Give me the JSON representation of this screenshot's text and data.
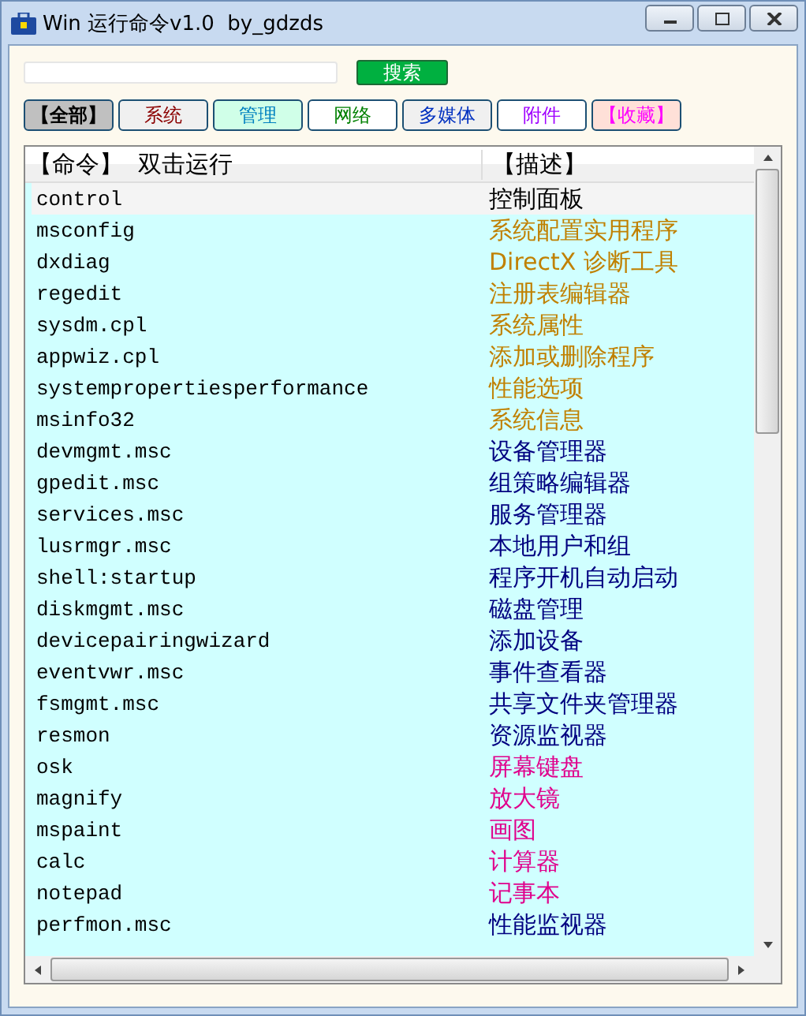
{
  "window": {
    "title": "Win 运行命令v1.0  by_gdzds"
  },
  "search": {
    "button": "搜索"
  },
  "tabs": [
    {
      "label": "【全部】",
      "selected": true,
      "color": "#000000"
    },
    {
      "label": "系统",
      "selected": false,
      "color": "#8b0000"
    },
    {
      "label": "管理",
      "selected": false,
      "color": "#0080c0"
    },
    {
      "label": "网络",
      "selected": false,
      "color": "#008000"
    },
    {
      "label": "多媒体",
      "selected": false,
      "color": "#0030c0"
    },
    {
      "label": "附件",
      "selected": false,
      "color": "#a000ff"
    },
    {
      "label": "【收藏】",
      "selected": false,
      "color": "#ff00ff"
    }
  ],
  "table": {
    "columns": [
      "【命令】  双击运行",
      "【描述】"
    ],
    "rows": [
      {
        "command": "control",
        "description": "控制面板",
        "selected": true,
        "color": "#000000"
      },
      {
        "command": "msconfig",
        "description": "系统配置实用程序",
        "selected": false,
        "color": "#c08000"
      },
      {
        "command": "dxdiag",
        "description": "DirectX 诊断工具",
        "selected": false,
        "color": "#c08000"
      },
      {
        "command": "regedit",
        "description": "注册表编辑器",
        "selected": false,
        "color": "#c08000"
      },
      {
        "command": "sysdm.cpl",
        "description": "系统属性",
        "selected": false,
        "color": "#c08000"
      },
      {
        "command": "appwiz.cpl",
        "description": "添加或删除程序",
        "selected": false,
        "color": "#c08000"
      },
      {
        "command": "systempropertiesperformance",
        "description": "性能选项",
        "selected": false,
        "color": "#c08000"
      },
      {
        "command": "msinfo32",
        "description": "系统信息",
        "selected": false,
        "color": "#c08000"
      },
      {
        "command": "devmgmt.msc",
        "description": "设备管理器",
        "selected": false,
        "color": "#000080"
      },
      {
        "command": "gpedit.msc",
        "description": "组策略编辑器",
        "selected": false,
        "color": "#000080"
      },
      {
        "command": "services.msc",
        "description": "服务管理器",
        "selected": false,
        "color": "#000080"
      },
      {
        "command": "lusrmgr.msc",
        "description": "本地用户和组",
        "selected": false,
        "color": "#000080"
      },
      {
        "command": "shell:startup",
        "description": "程序开机自动启动",
        "selected": false,
        "color": "#000080"
      },
      {
        "command": "diskmgmt.msc",
        "description": "磁盘管理",
        "selected": false,
        "color": "#000080"
      },
      {
        "command": "devicepairingwizard",
        "description": "添加设备",
        "selected": false,
        "color": "#000080"
      },
      {
        "command": "eventvwr.msc",
        "description": "事件查看器",
        "selected": false,
        "color": "#000080"
      },
      {
        "command": "fsmgmt.msc",
        "description": "共享文件夹管理器",
        "selected": false,
        "color": "#000080"
      },
      {
        "command": "resmon",
        "description": "资源监视器",
        "selected": false,
        "color": "#000080"
      },
      {
        "command": "osk",
        "description": "屏幕键盘",
        "selected": false,
        "color": "#e0008c"
      },
      {
        "command": "magnify",
        "description": "放大镜",
        "selected": false,
        "color": "#e0008c"
      },
      {
        "command": "mspaint",
        "description": "画图",
        "selected": false,
        "color": "#e0008c"
      },
      {
        "command": "calc",
        "description": "计算器",
        "selected": false,
        "color": "#e0008c"
      },
      {
        "command": "notepad",
        "description": "记事本",
        "selected": false,
        "color": "#e0008c"
      },
      {
        "command": "perfmon.msc",
        "description": "性能监视器",
        "selected": false,
        "color": "#000080"
      }
    ]
  }
}
